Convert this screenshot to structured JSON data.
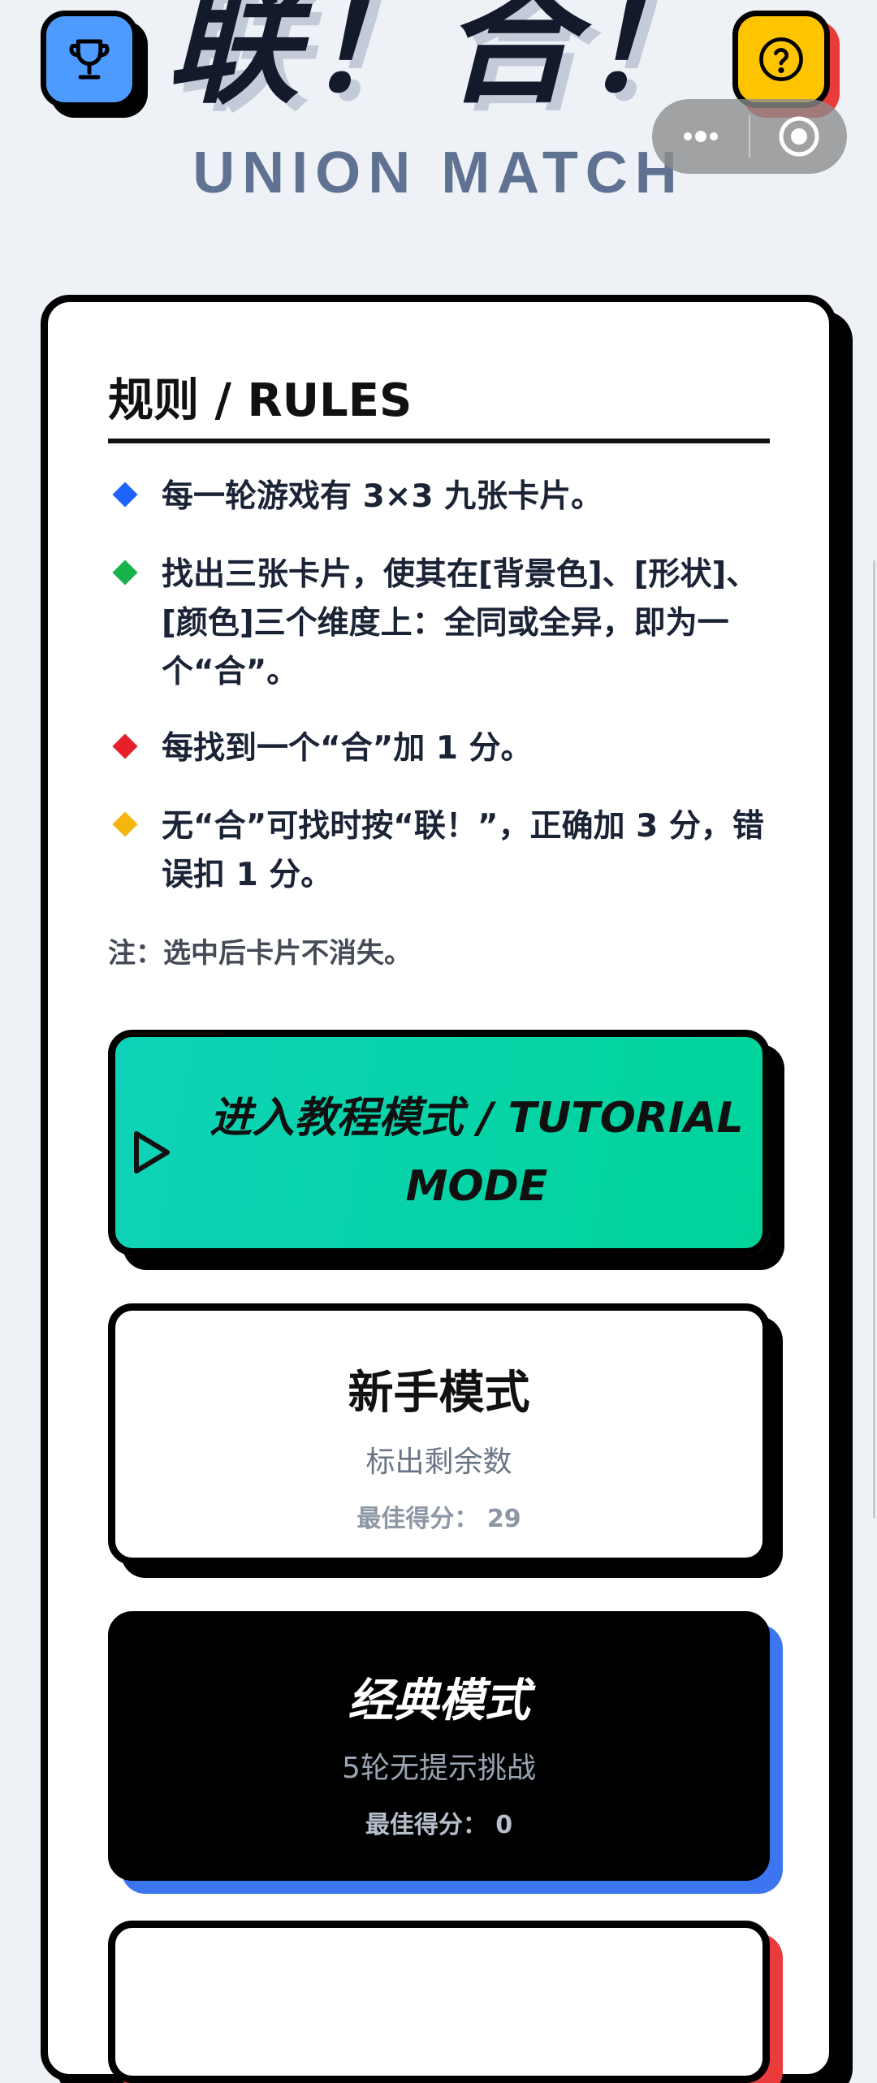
{
  "header": {
    "logo_cn": "联！合！",
    "logo_en": "UNION MATCH",
    "left_icon": "trophy-icon",
    "right_icon": "question-circle-icon",
    "capsule_icons": [
      "more-dots-icon",
      "target-icon"
    ]
  },
  "rules": {
    "title": "规则 / RULES",
    "items": [
      {
        "text": "每一轮游戏有 3×3 九张卡片。",
        "color": "#1f63ff"
      },
      {
        "text": "找出三张卡片，使其在[背景色]、[形状]、[颜色]三个维度上：全同或全异，即为一个“合”。",
        "color": "#18b24b"
      },
      {
        "text": "每找到一个“合”加 1 分。",
        "color": "#e5202a"
      },
      {
        "text": "无“合”可找时按“联！”，正确加 3 分，错误扣 1 分。",
        "color": "#f4b60f"
      }
    ],
    "note": "注：选中后卡片不消失。"
  },
  "modes": {
    "tutorial": {
      "label": "进入教程模式 / TUTORIAL MODE",
      "icon": "play-icon"
    },
    "beginner": {
      "title": "新手模式",
      "subtitle": "标出剩余数",
      "best": "最佳得分： 29"
    },
    "classic": {
      "title": "经典模式",
      "subtitle": "5轮无提示挑战",
      "best": "最佳得分： 0"
    }
  },
  "colors": {
    "background": "#eef1f6",
    "trophy_button": "#4d9bff",
    "help_button": "#ffc400",
    "help_shadow": "#ea3b3b",
    "tutorial_green": "#00d39a",
    "classic_shadow": "#3b76f0"
  }
}
